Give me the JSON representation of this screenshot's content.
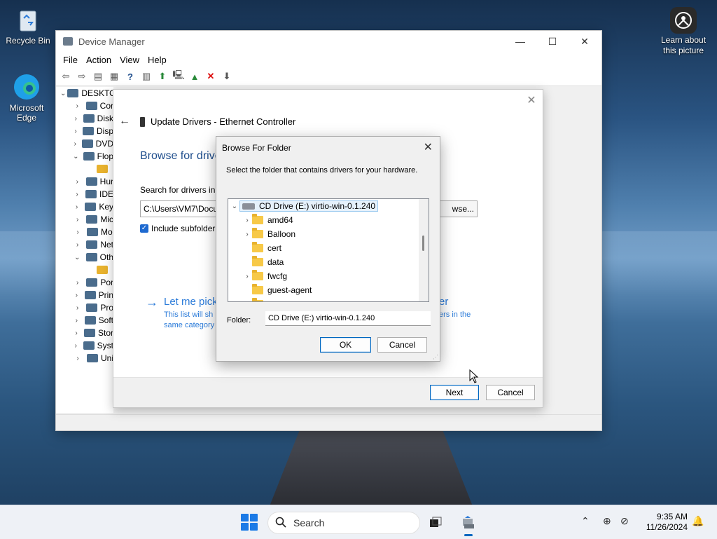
{
  "desktop": {
    "icons": [
      {
        "label": "Recycle Bin"
      },
      {
        "label": "Microsoft Edge"
      }
    ],
    "learn_label": "Learn about this picture"
  },
  "device_manager": {
    "title": "Device Manager",
    "menu": [
      "File",
      "Action",
      "View",
      "Help"
    ],
    "tree_root": "DESKTO",
    "tree_items": [
      "Cor",
      "Disk",
      "Disp",
      "DVD",
      "Flop",
      "",
      "Hur",
      "IDE",
      "Key",
      "Mic",
      "Mo",
      "Net",
      "Oth",
      "",
      "Por",
      "Prin",
      "Pro",
      "Soft",
      "Stor",
      "Syst",
      "Uni"
    ]
  },
  "update_drivers": {
    "title": "Update Drivers - Ethernet Controller",
    "heading": "Browse for drive",
    "search_label": "Search for drivers in t",
    "path_value": "C:\\Users\\VM7\\Docu",
    "browse_label": "wse...",
    "include_subfolders": "Include subfolder",
    "pick_title": "Let me pick",
    "pick_title_tail": "er",
    "pick_desc": "This list will sh same category",
    "pick_desc_tail": "ers in the",
    "next_label": "Next",
    "cancel_label": "Cancel"
  },
  "browse_folder": {
    "title": "Browse For Folder",
    "description": "Select the folder that contains drivers for your hardware.",
    "root": "CD Drive (E:) virtio-win-0.1.240",
    "folders": [
      {
        "name": "amd64",
        "expandable": true
      },
      {
        "name": "Balloon",
        "expandable": true
      },
      {
        "name": "cert",
        "expandable": false
      },
      {
        "name": "data",
        "expandable": false
      },
      {
        "name": "fwcfg",
        "expandable": true
      },
      {
        "name": "guest-agent",
        "expandable": false
      }
    ],
    "folder_label": "Folder:",
    "folder_value": "CD Drive (E:) virtio-win-0.1.240",
    "ok_label": "OK",
    "cancel_label": "Cancel"
  },
  "taskbar": {
    "search_placeholder": "Search",
    "time": "9:35 AM",
    "date": "11/26/2024"
  },
  "colors": {
    "accent": "#0067c0",
    "link": "#2b7bd9",
    "heading": "#1e4d8c",
    "folder": "#f7c948"
  }
}
